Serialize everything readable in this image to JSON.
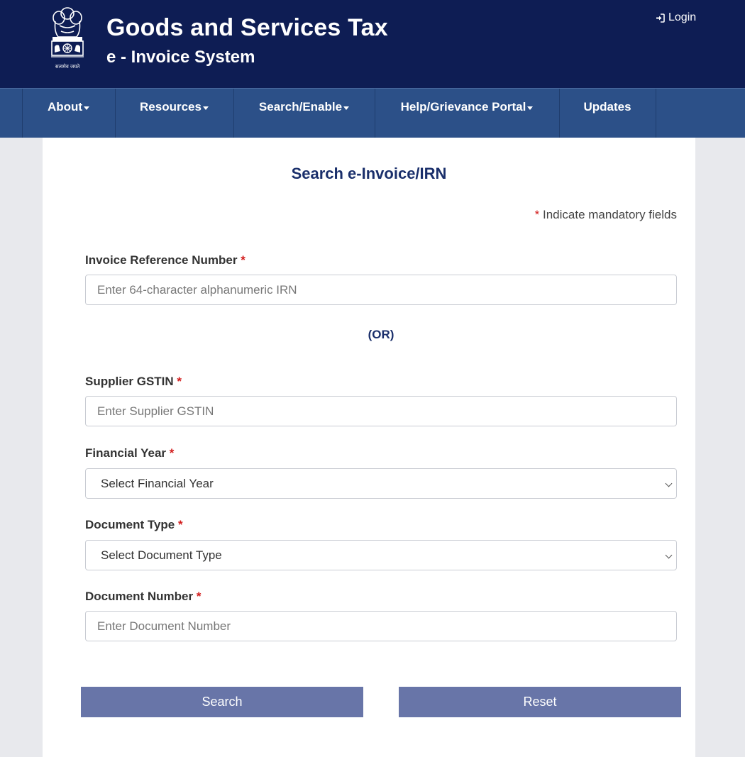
{
  "header": {
    "emblem_motto": "सत्यमेव जयते",
    "title": "Goods and Services Tax",
    "subtitle": "e - Invoice System",
    "login_label": "Login"
  },
  "nav": {
    "items": [
      {
        "label": "About",
        "dropdown": true
      },
      {
        "label": "Resources",
        "dropdown": true
      },
      {
        "label": "Search/Enable",
        "dropdown": true
      },
      {
        "label": "Help/Grievance Portal",
        "dropdown": true
      },
      {
        "label": "Updates",
        "dropdown": false
      }
    ]
  },
  "form": {
    "title": "Search e-Invoice/IRN",
    "mandatory_asterisk": "*",
    "mandatory_note": "Indicate mandatory fields",
    "irn": {
      "label": "Invoice Reference Number",
      "required": "*",
      "placeholder": "Enter 64-character alphanumeric IRN",
      "value": ""
    },
    "or_text": "(OR)",
    "gstin": {
      "label": "Supplier GSTIN",
      "required": "*",
      "placeholder": "Enter Supplier GSTIN",
      "value": ""
    },
    "financial_year": {
      "label": "Financial Year",
      "required": "*",
      "selected": "Select Financial Year"
    },
    "document_type": {
      "label": "Document Type",
      "required": "*",
      "selected": "Select Document Type"
    },
    "document_number": {
      "label": "Document Number",
      "required": "*",
      "placeholder": "Enter Document Number",
      "value": ""
    },
    "search_label": "Search",
    "reset_label": "Reset"
  },
  "colors": {
    "header_bg": "#0e1d54",
    "nav_bg": "#2c5088",
    "title_color": "#1a2f6b",
    "required_color": "#d21c1c",
    "button_bg": "#6875a8"
  },
  "icons": {
    "emblem": "national-emblem-icon",
    "login": "sign-in-icon",
    "caret": "caret-down-icon",
    "select_arrow": "chevron-down-icon"
  }
}
